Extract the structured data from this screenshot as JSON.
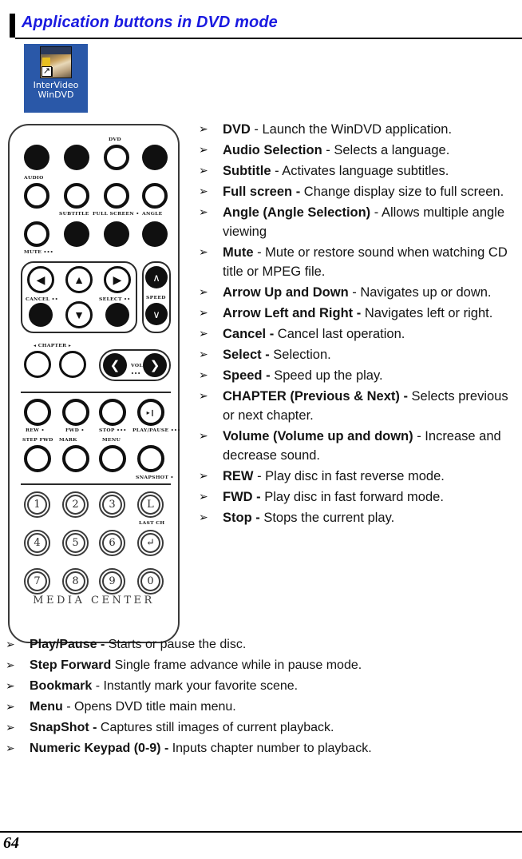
{
  "header": {
    "title": "Application buttons in DVD mode"
  },
  "desktop_icon": {
    "name": "InterVideo WinDVD",
    "line1": "InterVideo",
    "line2": "WinDVD",
    "shortcut_glyph": "↗",
    "selection_color": "#2a58a8"
  },
  "remote": {
    "brand": "MEDIA CENTER",
    "labels": {
      "dvd": "DVD",
      "audio": "AUDIO",
      "subtitle": "SUBTITLE",
      "full_screen": "FULL SCREEN •",
      "angle": "ANGLE",
      "mute": "MUTE •••",
      "cancel": "CANCEL ••",
      "select": "SELECT ••",
      "speed": "SPEED",
      "chapter": "◂ CHAPTER ▸",
      "volume": "VOL.",
      "volume_dots": "•••",
      "rew": "REW •",
      "fwd": "FWD •",
      "stop": "STOP •••",
      "play_pause": "PLAY/PAUSE •••",
      "step_fwd": "STEP FWD",
      "mark": "MARK",
      "menu": "MENU",
      "snapshot": "SNAPSHOT •",
      "last_ch": "LAST CH"
    },
    "glyphs": {
      "arrow_left": "◀",
      "arrow_right": "▶",
      "arrow_up": "▲",
      "arrow_down": "▼",
      "speed_up": "∧",
      "speed_down": "∨",
      "vol_down": "❮",
      "vol_up": "❯",
      "play_pause": "▸❙",
      "enter": "↵"
    },
    "keypad": [
      "1",
      "2",
      "3",
      "L",
      "4",
      "5",
      "6",
      "↵",
      "7",
      "8",
      "9",
      "0"
    ]
  },
  "bullet_glyph": "➢",
  "features_right": [
    {
      "term": "DVD",
      "sep": " - ",
      "desc": "Launch the WinDVD application."
    },
    {
      "term": "Audio Selection",
      "sep": " - ",
      "desc": "Selects a language."
    },
    {
      "term": "Subtitle",
      "sep": " - ",
      "desc": "Activates language subtitles."
    },
    {
      "term": "Full screen -",
      "sep": " ",
      "desc": "Change display size to full screen."
    },
    {
      "term": "Angle (Angle Selection)",
      "sep": " - ",
      "desc": "Allows multiple angle viewing"
    },
    {
      "term": "Mute",
      "sep": " - ",
      "desc": "Mute or restore sound when watching CD title or MPEG file."
    },
    {
      "term": "Arrow Up and Down",
      "sep": " - ",
      "desc": "Navigates up or down."
    },
    {
      "term": "Arrow Left and Right -",
      "sep": " ",
      "desc": "Navigates left or right."
    },
    {
      "term": "Cancel -",
      "sep": " ",
      "desc": "Cancel last operation."
    },
    {
      "term": "Select -",
      "sep": " ",
      "desc": "Selection."
    },
    {
      "term": "Speed -",
      "sep": " ",
      "desc": "Speed up the play."
    },
    {
      "term": "CHAPTER (Previous & Next) -",
      "sep": " ",
      "desc": "Selects previous or next chapter."
    },
    {
      "term": "Volume (Volume up and down)",
      "sep": " - ",
      "desc": "Increase and decrease sound."
    },
    {
      "term": "REW ",
      "sep": " - ",
      "desc": "Play disc in fast reverse mode."
    },
    {
      "term": "FWD -",
      "sep": " ",
      "desc": "Play disc in fast forward mode."
    },
    {
      "term": "Stop -",
      "sep": " ",
      "desc": "Stops the current play."
    }
  ],
  "features_bottom": [
    {
      "term": "Play/Pause -",
      "sep": " ",
      "desc": "Starts or pause the disc."
    },
    {
      "term": "Step Forward",
      "sep": "  ",
      "desc": "Single frame advance while in pause mode."
    },
    {
      "term": "Bookmark",
      "sep": " - ",
      "desc": "Instantly mark your favorite scene."
    },
    {
      "term": "Menu",
      "sep": " - ",
      "desc": "Opens DVD title main menu."
    },
    {
      "term": "SnapShot -",
      "sep": " ",
      "desc": "Captures still images of current playback."
    },
    {
      "term": "Numeric Keypad (0-9) -",
      "sep": " ",
      "desc": "Inputs chapter number to playback."
    }
  ],
  "footer": {
    "page_number": "64"
  }
}
